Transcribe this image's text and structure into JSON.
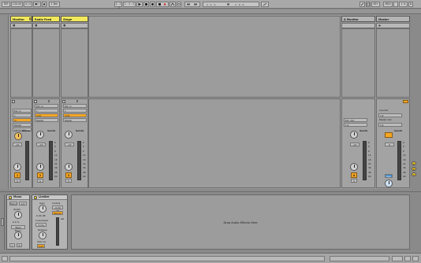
{
  "transport": {
    "tap": "TAP",
    "tempo": "120.00",
    "time_sig": "4 / 4",
    "metronome": "●○",
    "quantize": "1 Bar",
    "position": "1 . 1 . 1",
    "punch": "1 . 1 . 1",
    "key": "KEY",
    "midi": "MIDI",
    "cpu": "1 %",
    "disk": "D"
  },
  "tracks": [
    {
      "name": "Monitor",
      "header_color": "#f2e85c",
      "input_type": "Ext. In",
      "input_channel": "1",
      "monitor": "In",
      "output": "Master",
      "send_a": "Sends Only",
      "track_number": "1",
      "volume": "-inf",
      "pan": "C",
      "scale": [
        "6",
        "0",
        "6",
        "12",
        "18",
        "24",
        "36",
        "48",
        "60"
      ]
    },
    {
      "name": "Radio Feed",
      "header_color": "#f2e85c",
      "input_type": "Ext. In",
      "input_channel": "1",
      "monitor": "Auto",
      "output": "Master",
      "send_a": "Master",
      "track_number": "2",
      "volume": "-inf",
      "pan": "C",
      "scale": [
        "6",
        "0",
        "6",
        "12",
        "18",
        "24",
        "36",
        "48",
        "60"
      ]
    },
    {
      "name": "Stage",
      "header_color": "#f2e85c",
      "input_type": "Ext. In",
      "input_channel": "1",
      "monitor": "Auto",
      "output": "Master",
      "send_a": "Master",
      "track_number": "3",
      "volume": "-inf",
      "pan": "C",
      "scale": [
        "6",
        "0",
        "6",
        "12",
        "18",
        "24",
        "36",
        "48",
        "60"
      ]
    }
  ],
  "returns": [
    {
      "name": "A Monitor",
      "output": "Ext. Out",
      "channel": "1/2",
      "track_letter": "A",
      "volume": "-inf",
      "pan": "C",
      "scale": [
        "6",
        "0",
        "6",
        "12",
        "18",
        "24",
        "36",
        "48",
        "60"
      ]
    }
  ],
  "master": {
    "name": "Master",
    "cue_out": "Cue Out",
    "cue_ch": "1/2",
    "master_out": "Master Out",
    "master_ch": "1/2",
    "volume": "0",
    "pan": "C",
    "solo": "Solo",
    "scale": [
      "6",
      "0",
      "6",
      "12",
      "18",
      "24",
      "36",
      "48",
      "60"
    ]
  },
  "sends_label": "Sends",
  "devices": {
    "mono": {
      "title": "Mono",
      "width_label": "Width",
      "width_value": "0.0 %",
      "bass": "Bass Mono",
      "left": "L",
      "right": "R",
      "mode": "Mono"
    },
    "limiter": {
      "title": "Limiter",
      "gain_label": "Gain",
      "gain_value": "0.00 dB",
      "ceiling_label": "Ceiling",
      "ceiling_value": "-0.30 dB",
      "stereo": "Stereo",
      "lookahead": "Lookahead",
      "lookahead_value": "3 ms",
      "release_label": "Release",
      "release_value": "300 ms",
      "auto": "Auto",
      "gain_reduction": "GR"
    }
  },
  "drop_area_text": "Drop Audio Effects Here",
  "side_letters": [
    "A",
    "B"
  ],
  "crossfader": [
    "A",
    "B",
    "S"
  ]
}
